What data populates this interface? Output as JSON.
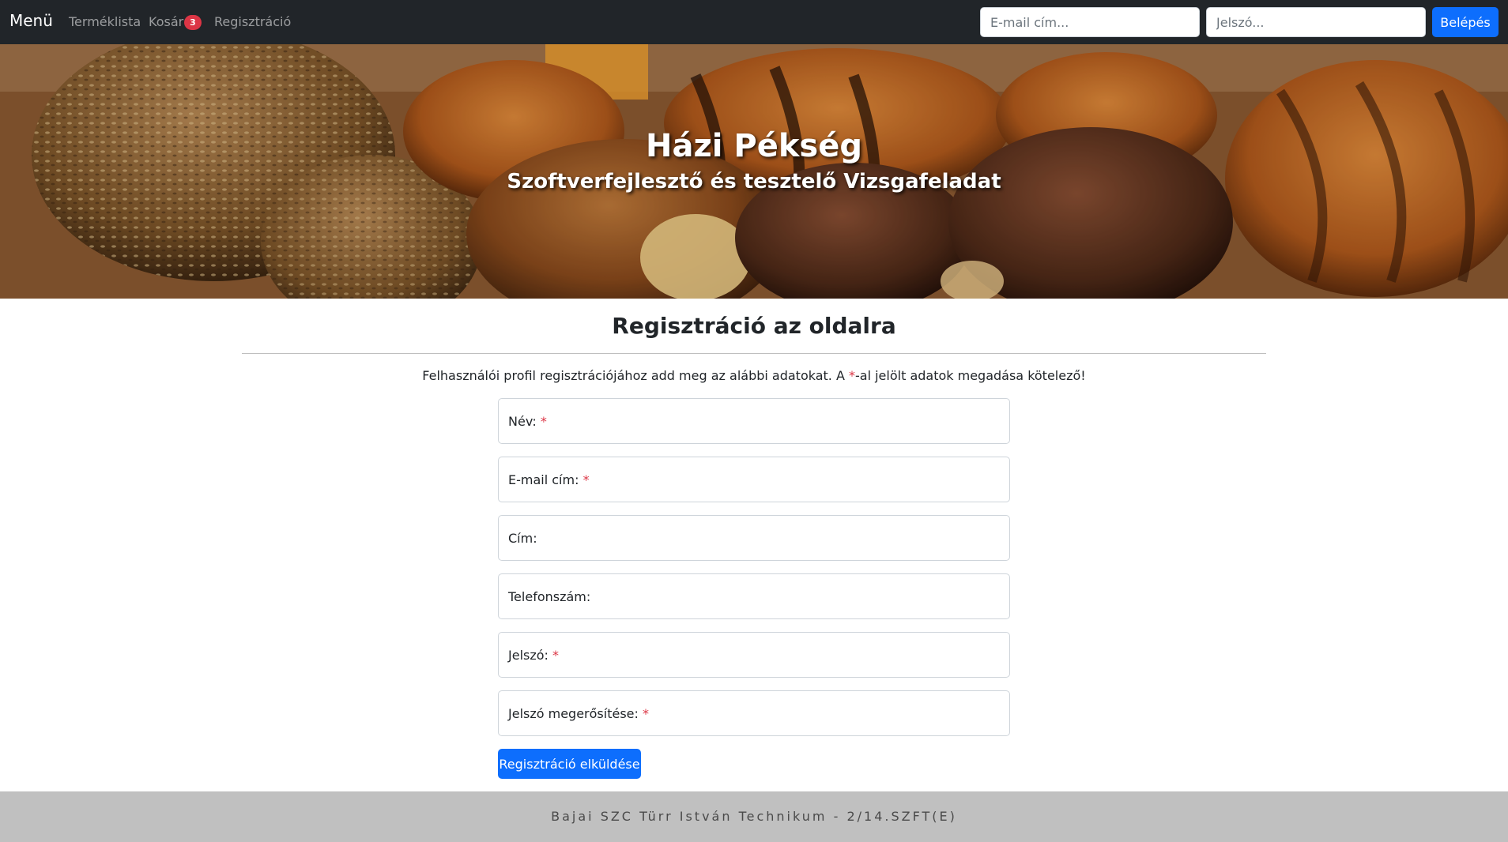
{
  "navbar": {
    "brand": "Menü",
    "links": [
      {
        "label": "Terméklista"
      },
      {
        "label": "Kosár",
        "badge": "3"
      },
      {
        "label": "Regisztráció"
      }
    ],
    "login": {
      "email_placeholder": "E-mail cím...",
      "password_placeholder": "Jelszó...",
      "button_label": "Belépés"
    }
  },
  "hero": {
    "title": "Házi Pékség",
    "subtitle": "Szoftverfejlesztő és tesztelő Vizsgafeladat"
  },
  "main": {
    "heading": "Regisztráció az oldalra",
    "intro_before": "Felhasználói profil regisztrációjához add meg az alábbi adatokat. A ",
    "intro_star": "*",
    "intro_after": "-al jelölt adatok megadása kötelező!",
    "fields": [
      {
        "label": "Név:",
        "required": "*"
      },
      {
        "label": "E-mail cím:",
        "required": "*"
      },
      {
        "label": "Cím:",
        "required": ""
      },
      {
        "label": "Telefonszám:",
        "required": ""
      },
      {
        "label": "Jelszó:",
        "required": "*"
      },
      {
        "label": "Jelszó megerősítése:",
        "required": "*"
      }
    ],
    "submit_label": "Regisztráció elküldése"
  },
  "footer": {
    "text": "Bajai SZC Türr István Technikum - 2/14.SZFT(E)"
  },
  "colors": {
    "navbar_bg": "#212529",
    "primary": "#0d6efd",
    "danger": "#dc3545",
    "footer_bg": "#c0c0c0"
  }
}
